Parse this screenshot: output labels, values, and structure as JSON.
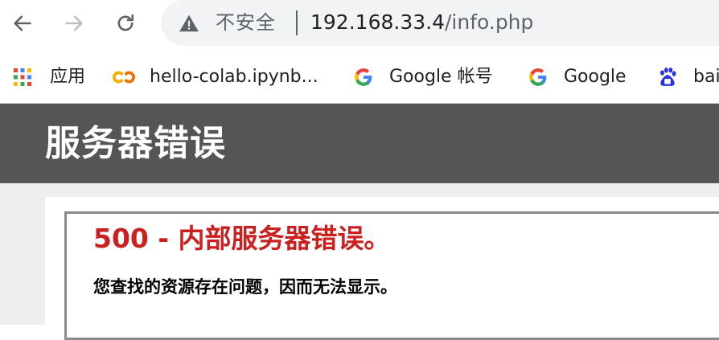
{
  "toolbar": {
    "back_icon": "back-arrow-icon",
    "forward_icon": "forward-arrow-icon",
    "reload_icon": "reload-icon"
  },
  "omnibox": {
    "security_icon": "warning-triangle-icon",
    "security_label": "不安全",
    "url_host": "192.168.33.4",
    "url_path": "/info.php"
  },
  "bookmarks": {
    "items": [
      {
        "label": "应用",
        "icon": "apps-grid-icon"
      },
      {
        "label": "hello-colab.ipynb...",
        "icon": "colab-icon"
      },
      {
        "label": "Google 帐号",
        "icon": "google-g-icon"
      },
      {
        "label": "Google",
        "icon": "google-g-icon"
      },
      {
        "label": "bai",
        "icon": "baidu-paw-icon"
      }
    ]
  },
  "page": {
    "header_title": "服务器错误",
    "error_heading": "500 - 内部服务器错误。",
    "error_description": "您查找的资源存在问题，因而无法显示。"
  },
  "colors": {
    "header_bg": "#555555",
    "error_red": "#cc1f1f",
    "page_bg": "#eeeeee"
  }
}
